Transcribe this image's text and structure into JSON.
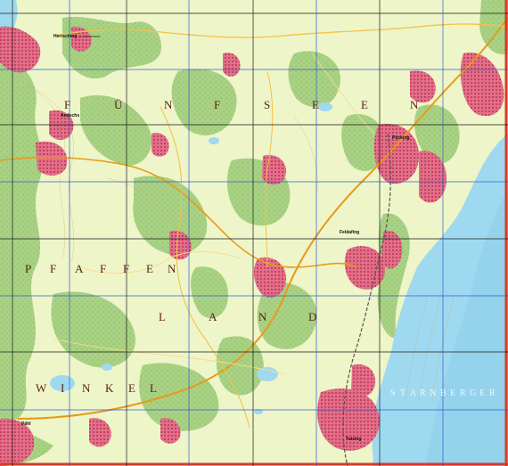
{
  "map": {
    "colors": {
      "meadow": "#eef5c8",
      "forest": "#a9d184",
      "forest_dark": "#8fc46b",
      "settlement": "#e07088",
      "settlement_core": "#cc3d63",
      "lake": "#9fd9f0",
      "lake_deep": "#8ccbe6",
      "grid_black": "#1a1a1a",
      "grid_blue": "#2f5fd0",
      "road_main": "#e89a1a",
      "rail": "#555555",
      "border": "#d53b2a"
    },
    "regions": [
      {
        "name": "FÜNFSEEN",
        "letters": [
          "F",
          "Ü",
          "N",
          "F",
          "S",
          "E",
          "E",
          "N"
        ]
      },
      {
        "name": "PFAFFENWINKEL",
        "letters_line1": [
          "P",
          "F",
          "A",
          "F",
          "F",
          "E",
          "N"
        ],
        "letters_line2": [
          "W",
          "I",
          "N",
          "K",
          "E",
          "L"
        ]
      },
      {
        "name": "LAND",
        "letters": [
          "L",
          "A",
          "N",
          "D"
        ]
      }
    ],
    "lake_name": {
      "letters": [
        "S",
        "T",
        "A",
        "R",
        "N",
        "B",
        "E",
        "R",
        "G",
        "E",
        "R"
      ]
    },
    "towns": [
      {
        "id": "herrsching",
        "name": "Herrsching",
        "sub": "a. Ammersee"
      },
      {
        "id": "andechs",
        "name": "Andechs",
        "sub": ""
      },
      {
        "id": "poecking",
        "name": "Pöcking",
        "sub": ""
      },
      {
        "id": "feldafing",
        "name": "Feldafing",
        "sub": ""
      },
      {
        "id": "tutzing",
        "name": "Tutzing",
        "sub": ""
      },
      {
        "id": "pahl",
        "name": "Pähl",
        "sub": ""
      }
    ]
  }
}
